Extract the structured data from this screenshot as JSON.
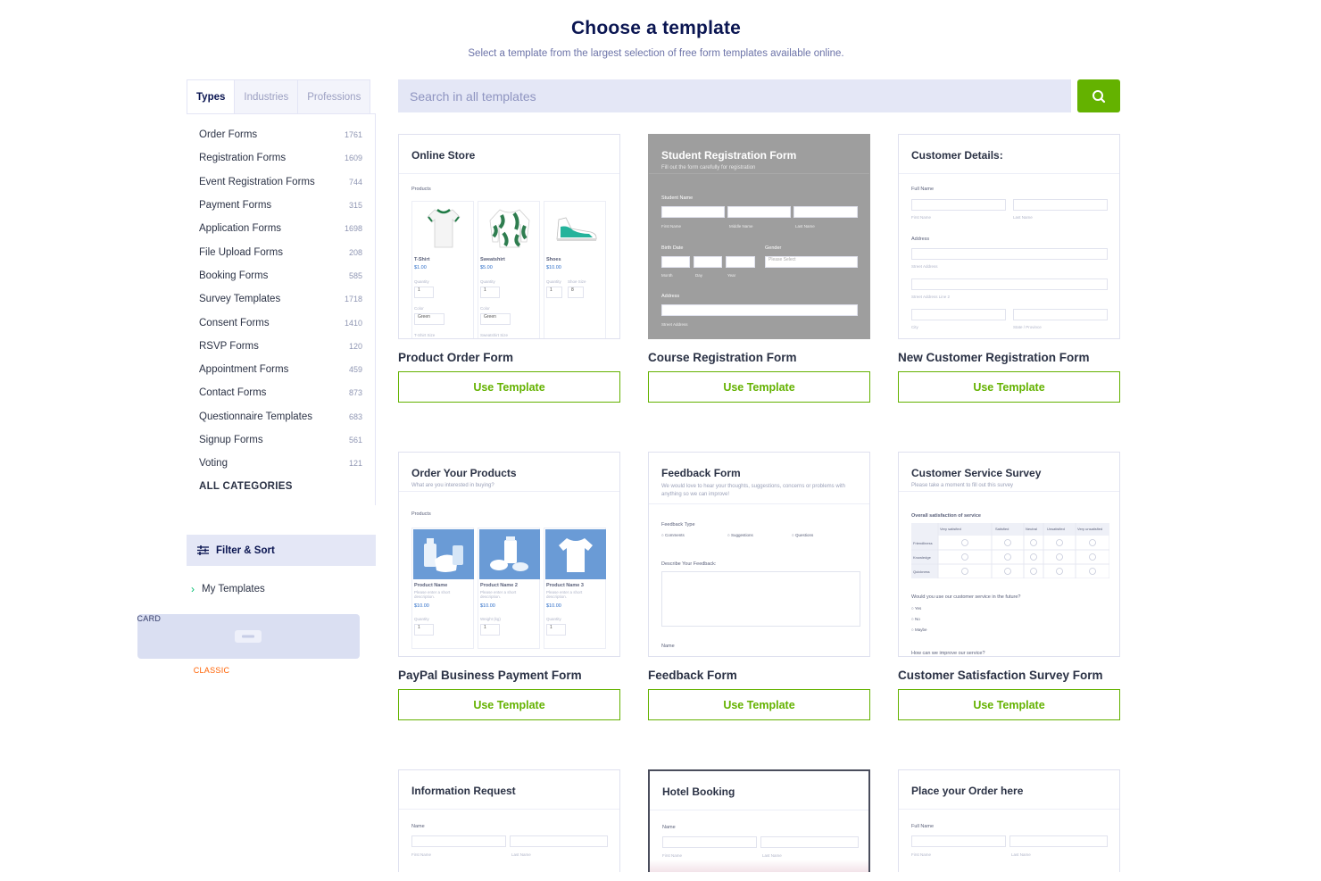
{
  "header": {
    "title": "Choose a template",
    "subtitle": "Select a template from the largest selection of free form templates available online."
  },
  "sidebar": {
    "tabs": [
      "Types",
      "Industries",
      "Professions"
    ],
    "categories": [
      {
        "label": "Order Forms",
        "count": "1761"
      },
      {
        "label": "Registration Forms",
        "count": "1609"
      },
      {
        "label": "Event Registration Forms",
        "count": "744"
      },
      {
        "label": "Payment Forms",
        "count": "315"
      },
      {
        "label": "Application Forms",
        "count": "1698"
      },
      {
        "label": "File Upload Forms",
        "count": "208"
      },
      {
        "label": "Booking Forms",
        "count": "585"
      },
      {
        "label": "Survey Templates",
        "count": "1718"
      },
      {
        "label": "Consent Forms",
        "count": "1410"
      },
      {
        "label": "RSVP Forms",
        "count": "120"
      },
      {
        "label": "Appointment Forms",
        "count": "459"
      },
      {
        "label": "Contact Forms",
        "count": "873"
      },
      {
        "label": "Questionnaire Templates",
        "count": "683"
      },
      {
        "label": "Signup Forms",
        "count": "561"
      },
      {
        "label": "Voting",
        "count": "121"
      }
    ],
    "all_categories": "ALL CATEGORIES",
    "filter_label": "Filter & Sort",
    "my_templates": "My Templates",
    "views": {
      "classic": "CLASSIC",
      "card": "CARD"
    }
  },
  "search": {
    "placeholder": "Search in all templates"
  },
  "accent": "#64b200",
  "use_template_label": "Use Template",
  "templates": [
    {
      "title": "Product Order Form",
      "preview_title": "Online Store",
      "section": "Products",
      "products": [
        {
          "name": "T-Shirt",
          "price": "$1.00",
          "qty_label": "Quantity",
          "qty": "1",
          "opt_label": "Color",
          "opt": "Green",
          "extra": "T-Shirt Size"
        },
        {
          "name": "Sweatshirt",
          "price": "$5.00",
          "qty_label": "Quantity",
          "qty": "1",
          "opt_label": "Color",
          "opt": "Green",
          "extra": "Sweatshirt Size"
        },
        {
          "name": "Shoes",
          "price": "$10.00",
          "qty_label": "Quantity",
          "qty": "1",
          "opt_label": "Shoe Size",
          "opt": "8",
          "extra": ""
        }
      ]
    },
    {
      "title": "Course Registration Form",
      "preview_title": "Student Registration Form",
      "preview_sub": "Fill out the form carefully for registration",
      "student_name": "Student Name",
      "first": "First Name",
      "middle": "Middle Name",
      "last": "Last Name",
      "birth": "Birth Date",
      "gender": "Gender",
      "please_select": "Please Select",
      "month": "Month",
      "day": "Day",
      "year": "Year",
      "address": "Address",
      "street": "Street Address"
    },
    {
      "title": "New Customer Registration Form",
      "preview_title": "Customer Details:",
      "full_name": "Full Name",
      "first": "First Name",
      "last": "Last Name",
      "address": "Address",
      "street": "Street Address",
      "street2": "Street Address Line 2",
      "city": "City",
      "state": "State / Province"
    },
    {
      "title": "PayPal Business Payment Form",
      "preview_title": "Order Your Products",
      "preview_sub": "What are you interested in buying?",
      "section": "Products",
      "products": [
        {
          "name": "Product Name",
          "desc": "Please enter a short description.",
          "price": "$10.00",
          "qty_label": "Quantity",
          "qty": "1"
        },
        {
          "name": "Product Name 2",
          "desc": "Please enter a short description.",
          "price": "$10.00",
          "qty_label": "Weight (kg)",
          "qty": "1"
        },
        {
          "name": "Product Name 3",
          "desc": "Please enter a short description.",
          "price": "$10.00",
          "qty_label": "Quantity",
          "qty": "1"
        }
      ]
    },
    {
      "title": "Feedback Form",
      "preview_title": "Feedback Form",
      "preview_sub": "We would love to hear your thoughts, suggestions, concerns or problems with anything so we can improve!",
      "type_label": "Feedback Type",
      "types": [
        "Comments",
        "Suggestions",
        "Questions"
      ],
      "describe": "Describe Your Feedback:",
      "name": "Name"
    },
    {
      "title": "Customer Satisfaction Survey Form",
      "preview_title": "Customer Service Survey",
      "preview_sub": "Please take a moment to fill out this survey",
      "overall": "Overall satisfaction of service",
      "cols": [
        "Very satisfied",
        "Satisfied",
        "Neutral",
        "Unsatisfied",
        "Very unsatisfied"
      ],
      "rows": [
        "Friendliness",
        "Knowledge",
        "Quickness"
      ],
      "question": "Would you use our customer service in the future?",
      "answers": [
        "Yes",
        "No",
        "Maybe"
      ],
      "next": "How can we improve our service?"
    },
    {
      "title": "",
      "preview_title": "Information Request",
      "name": "Name",
      "first": "First Name",
      "last": "Last Name"
    },
    {
      "title": "",
      "preview_title": "Hotel Booking",
      "name": "Name",
      "first": "First Name",
      "last": "Last Name"
    },
    {
      "title": "",
      "preview_title": "Place your Order here",
      "name": "Full Name",
      "first": "First Name",
      "last": "Last Name"
    }
  ]
}
